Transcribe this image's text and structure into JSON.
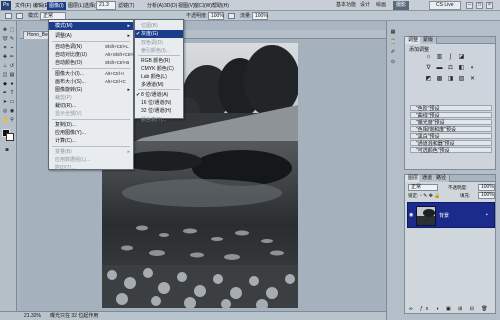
{
  "menubar": {
    "logo": "Ps",
    "items": [
      "文件(F)",
      "编辑(E)",
      "图像(I)",
      "图层(L)",
      "选择(S)",
      "滤镜(T)",
      "分析(A)",
      "3D(D)",
      "视图(V)",
      "窗口(W)",
      "帮助(H)"
    ],
    "zoom": "21.3",
    "workspaces": [
      "基本功能",
      "设计",
      "绘画",
      "摄影"
    ],
    "cslive": "CS Live"
  },
  "options": {
    "mode_label": "模式:",
    "mode_value": "正常",
    "opacity_label": "不透明度:",
    "opacity_value": "100%",
    "flow_label": "流量:",
    "flow_value": "100%"
  },
  "document": {
    "tab": "Hono_Before"
  },
  "image_menu": {
    "items": [
      {
        "label": "模式(M)",
        "shortcut": "",
        "sub": true,
        "state": "hl"
      },
      {
        "label": "调整(A)",
        "shortcut": "",
        "sub": true,
        "state": ""
      },
      {
        "label": "自动色调(N)",
        "shortcut": "Shift+Ctrl+L",
        "sub": false,
        "state": ""
      },
      {
        "label": "自动对比度(U)",
        "shortcut": "Alt+Shift+Ctrl+L",
        "sub": false,
        "state": ""
      },
      {
        "label": "自动颜色(O)",
        "shortcut": "Shift+Ctrl+B",
        "sub": false,
        "state": ""
      },
      {
        "label": "图像大小(I)...",
        "shortcut": "Alt+Ctrl+I",
        "sub": false,
        "state": ""
      },
      {
        "label": "画布大小(S)...",
        "shortcut": "Alt+Ctrl+C",
        "sub": false,
        "state": ""
      },
      {
        "label": "图像旋转(G)",
        "shortcut": "",
        "sub": true,
        "state": ""
      },
      {
        "label": "裁剪(P)",
        "shortcut": "",
        "sub": false,
        "state": "dis"
      },
      {
        "label": "裁切(R)...",
        "shortcut": "",
        "sub": false,
        "state": ""
      },
      {
        "label": "显示全部(V)",
        "shortcut": "",
        "sub": false,
        "state": "dis"
      },
      {
        "label": "复制(D)...",
        "shortcut": "",
        "sub": false,
        "state": ""
      },
      {
        "label": "应用图像(Y)...",
        "shortcut": "",
        "sub": false,
        "state": ""
      },
      {
        "label": "计算(C)...",
        "shortcut": "",
        "sub": false,
        "state": ""
      },
      {
        "label": "变量(B)",
        "shortcut": "",
        "sub": true,
        "state": "dis"
      },
      {
        "label": "应用数据组(L)...",
        "shortcut": "",
        "sub": false,
        "state": "dis"
      },
      {
        "label": "陷印(T)...",
        "shortcut": "",
        "sub": false,
        "state": "dis"
      }
    ]
  },
  "mode_menu": {
    "items": [
      {
        "label": "位图(B)",
        "check": "",
        "state": "dis"
      },
      {
        "label": "灰度(G)",
        "check": "✔",
        "state": "hl"
      },
      {
        "label": "双色调(D)",
        "check": "",
        "state": "dis"
      },
      {
        "label": "索引颜色(I)...",
        "check": "",
        "state": "dis"
      },
      {
        "label": "RGB 颜色(R)",
        "check": "",
        "state": ""
      },
      {
        "label": "CMYK 颜色(C)",
        "check": "",
        "state": ""
      },
      {
        "label": "Lab 颜色(L)",
        "check": "",
        "state": ""
      },
      {
        "label": "多通道(M)",
        "check": "",
        "state": ""
      },
      {
        "label": "8 位/通道(A)",
        "check": "✔",
        "state": ""
      },
      {
        "label": "16 位/通道(N)",
        "check": "",
        "state": ""
      },
      {
        "label": "32 位/通道(H)",
        "check": "",
        "state": ""
      },
      {
        "label": "颜色表(T)...",
        "check": "",
        "state": "dis"
      }
    ]
  },
  "adjustments_panel": {
    "tab": "调整",
    "tab2": "蒙版",
    "heading": "添加调整",
    "presets": [
      "\"色阶\"预设",
      "\"曲线\"预设",
      "\"曝光度\"预设",
      "\"色相/饱和度\"预设",
      "\"黑白\"预设",
      "\"通道混和器\"预设",
      "\"可选颜色\"预设"
    ]
  },
  "layers_panel": {
    "tabs": [
      "图层",
      "通道",
      "路径"
    ],
    "blend_mode": "正常",
    "opacity_label": "不透明度:",
    "opacity": "100%",
    "lock_label": "锁定:",
    "fill_label": "填充:",
    "fill": "100%",
    "layer_name": "背景"
  },
  "status": {
    "zoom": "21.32%",
    "info": "曝光只在 32 位起作用"
  }
}
